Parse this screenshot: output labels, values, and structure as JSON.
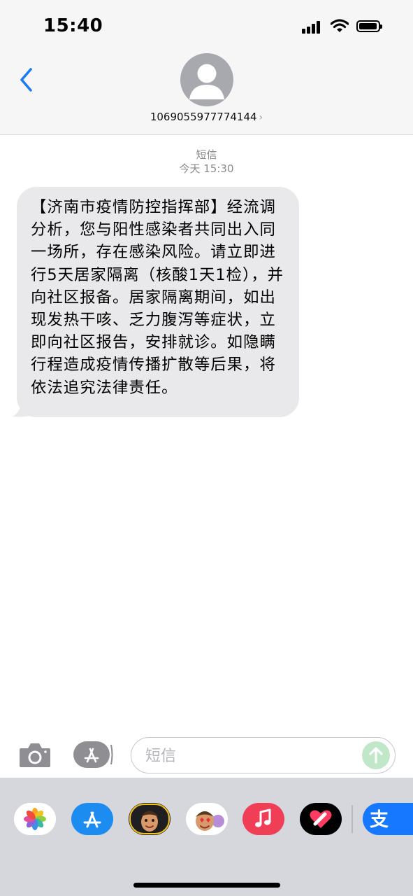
{
  "status_bar": {
    "time": "15:40",
    "signal_icon": "signal-bars-icon",
    "wifi_icon": "wifi-icon",
    "battery_icon": "battery-icon",
    "battery_level": 0.85
  },
  "header": {
    "back_icon": "chevron-left-icon",
    "avatar_icon": "person-silhouette-icon",
    "contact_number": "1069055977774144",
    "contact_chevron": "›"
  },
  "conversation": {
    "service_label": "短信",
    "timestamp": "今天 15:30",
    "message": "【济南市疫情防控指挥部】经流调分析，您与阳性感染者共同出入同一场所，存在感染风险。请立即进行5天居家隔离（核酸1天1检），并向社区报备。居家隔离期间，如出现发热干咳、乏力腹泻等症状，立即向社区报告，安排就诊。如隐瞒行程造成疫情传播扩散等后果，将依法追究法律责任。"
  },
  "input_bar": {
    "camera_icon": "camera-icon",
    "apps_icon": "app-store-icon",
    "placeholder": "短信",
    "send_icon": "arrow-up-icon"
  },
  "app_drawer": {
    "apps": [
      "photos-icon",
      "app-store-icon",
      "memoji-icon",
      "animoji-stickers-icon",
      "music-icon",
      "digital-touch-icon",
      "alipay-icon"
    ],
    "alipay_glyph": "支"
  },
  "colors": {
    "accent_blue": "#1a7bf5",
    "bubble_gray": "#e9e9eb",
    "send_green": "#bfe7c8",
    "bar_background": "#f6f6f6",
    "drawer_background": "#d5d7dc"
  }
}
